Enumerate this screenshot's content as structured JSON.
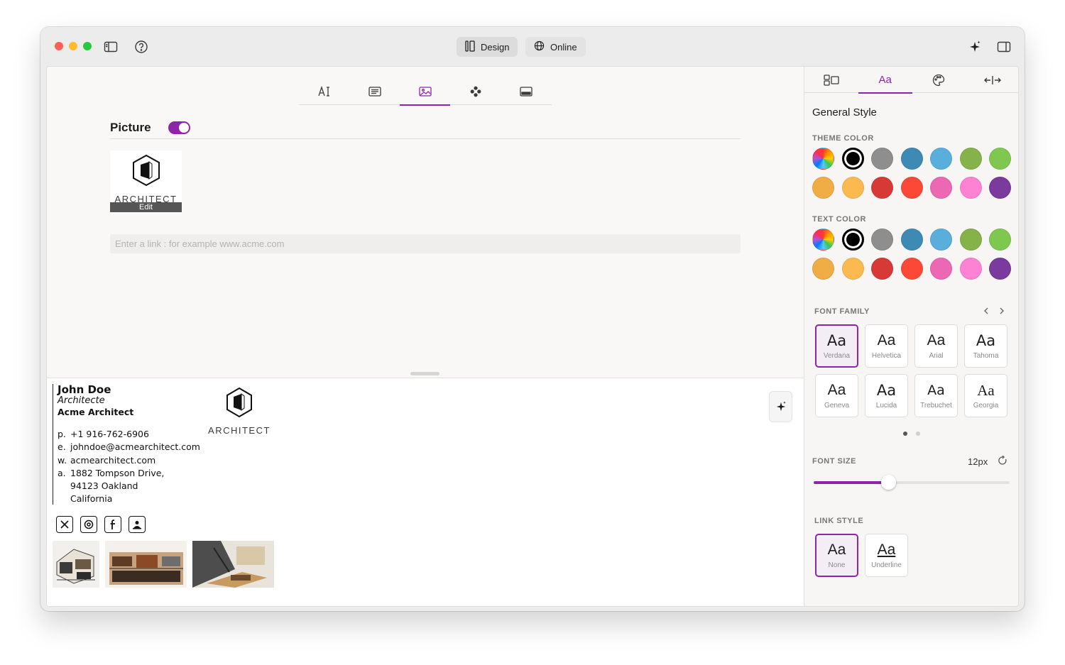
{
  "toolbar": {
    "design_label": "Design",
    "online_label": "Online"
  },
  "editor": {
    "section_title": "Picture",
    "picture_enabled": true,
    "picture_caption": "ARCHITECT",
    "edit_label": "Edit",
    "link_placeholder": "Enter a link : for example www.acme.com"
  },
  "signature": {
    "name": "John Doe",
    "role": "Architecte",
    "company": "Acme Architect",
    "phone_label": "p.",
    "phone": "+1 916-762-6906",
    "email_label": "e.",
    "email": "johndoe@acmearchitect.com",
    "web_label": "w.",
    "web": "acmearchitect.com",
    "address_label": "a.",
    "address_line1": "1882 Tompson Drive,",
    "address_line2": "94123 Oakland",
    "address_line3": "California",
    "logo_caption": "ARCHITECT",
    "socials": [
      "x-icon",
      "threads-icon",
      "facebook-icon",
      "contact-icon"
    ]
  },
  "side": {
    "tab_aa_label": "Aa",
    "title": "General Style",
    "theme_color_label": "THEME COLOR",
    "text_color_label": "TEXT COLOR",
    "font_family_label": "FONT FAMILY",
    "font_size_label": "FONT SIZE",
    "font_size_value": "12px",
    "font_size_fraction": 0.38,
    "link_style_label": "LINK STYLE",
    "colors": [
      "#000000",
      "#8e8e8e",
      "#3d8bb5",
      "#5aaedc",
      "#86b24a",
      "#7ec850",
      "#f0ad45",
      "#fbba50",
      "#d73a36",
      "#fc4937",
      "#ec68b3",
      "#fd82d3",
      "#7b3a9d"
    ],
    "fonts": [
      {
        "aa": "Aa",
        "name": "Verdana",
        "selected": true
      },
      {
        "aa": "Aa",
        "name": "Helvetica",
        "selected": false
      },
      {
        "aa": "Aa",
        "name": "Arial",
        "selected": false
      },
      {
        "aa": "Aa",
        "name": "Tahoma",
        "selected": false
      },
      {
        "aa": "Aa",
        "name": "Geneva",
        "selected": false
      },
      {
        "aa": "Aa",
        "name": "Lucida",
        "selected": false
      },
      {
        "aa": "Aa",
        "name": "Trebuchet",
        "selected": false
      },
      {
        "aa": "Aa",
        "name": "Georgia",
        "selected": false
      }
    ],
    "link_styles": [
      {
        "aa": "Aa",
        "name": "None",
        "selected": true
      },
      {
        "aa": "Aa",
        "name": "Underline",
        "selected": false
      }
    ]
  }
}
